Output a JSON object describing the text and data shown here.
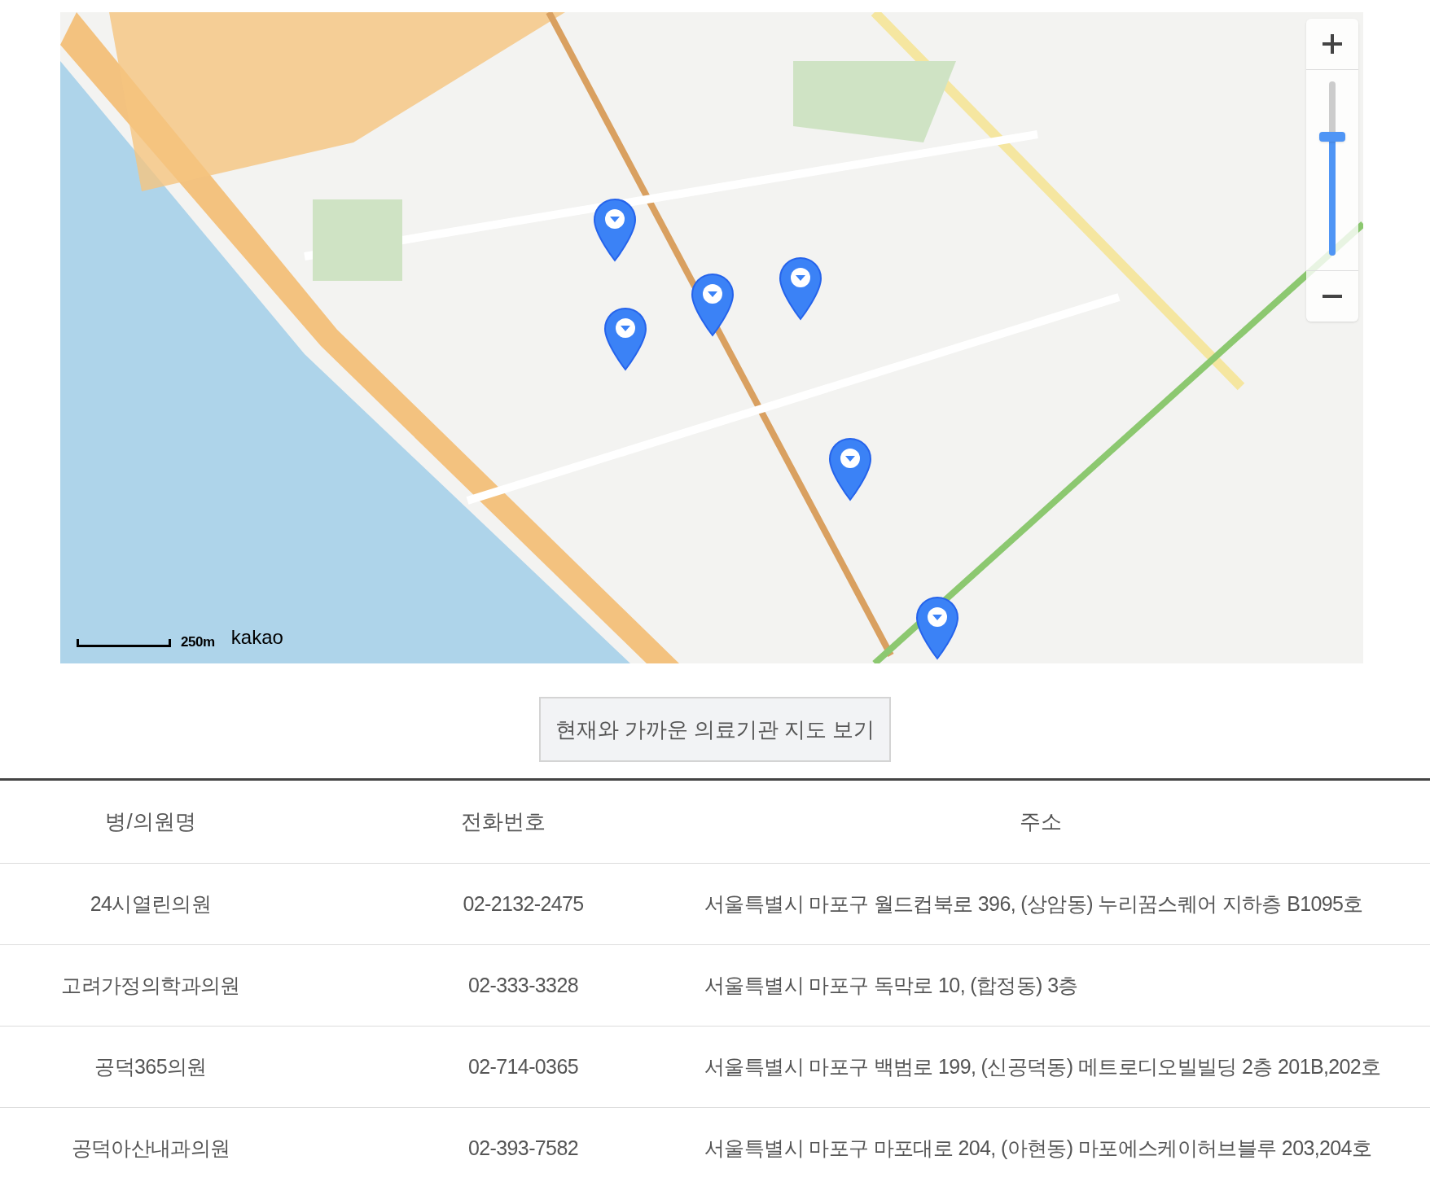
{
  "map": {
    "scale_label": "250m",
    "logo": "kakao",
    "zoom": {
      "level": 0.68
    }
  },
  "nearby_button": {
    "label": "현재와 가까운 의료기관 지도 보기"
  },
  "table": {
    "columns": [
      "병/의원명",
      "전화번호",
      "주소"
    ],
    "rows": [
      {
        "name": "24시열린의원",
        "phone": "02-2132-2475",
        "address": "서울특별시 마포구 월드컵북로 396, (상암동) 누리꿈스퀘어 지하층 B1095호"
      },
      {
        "name": "고려가정의학과의원",
        "phone": "02-333-3328",
        "address": "서울특별시 마포구 독막로 10, (합정동) 3층"
      },
      {
        "name": "공덕365의원",
        "phone": "02-714-0365",
        "address": "서울특별시 마포구 백범로 199, (신공덕동) 메트로디오빌빌딩 2층 201B,202호"
      },
      {
        "name": "공덕아산내과의원",
        "phone": "02-393-7582",
        "address": "서울특별시 마포구 마포대로 204, (아현동) 마포에스케이허브블루 203,204호"
      }
    ]
  }
}
